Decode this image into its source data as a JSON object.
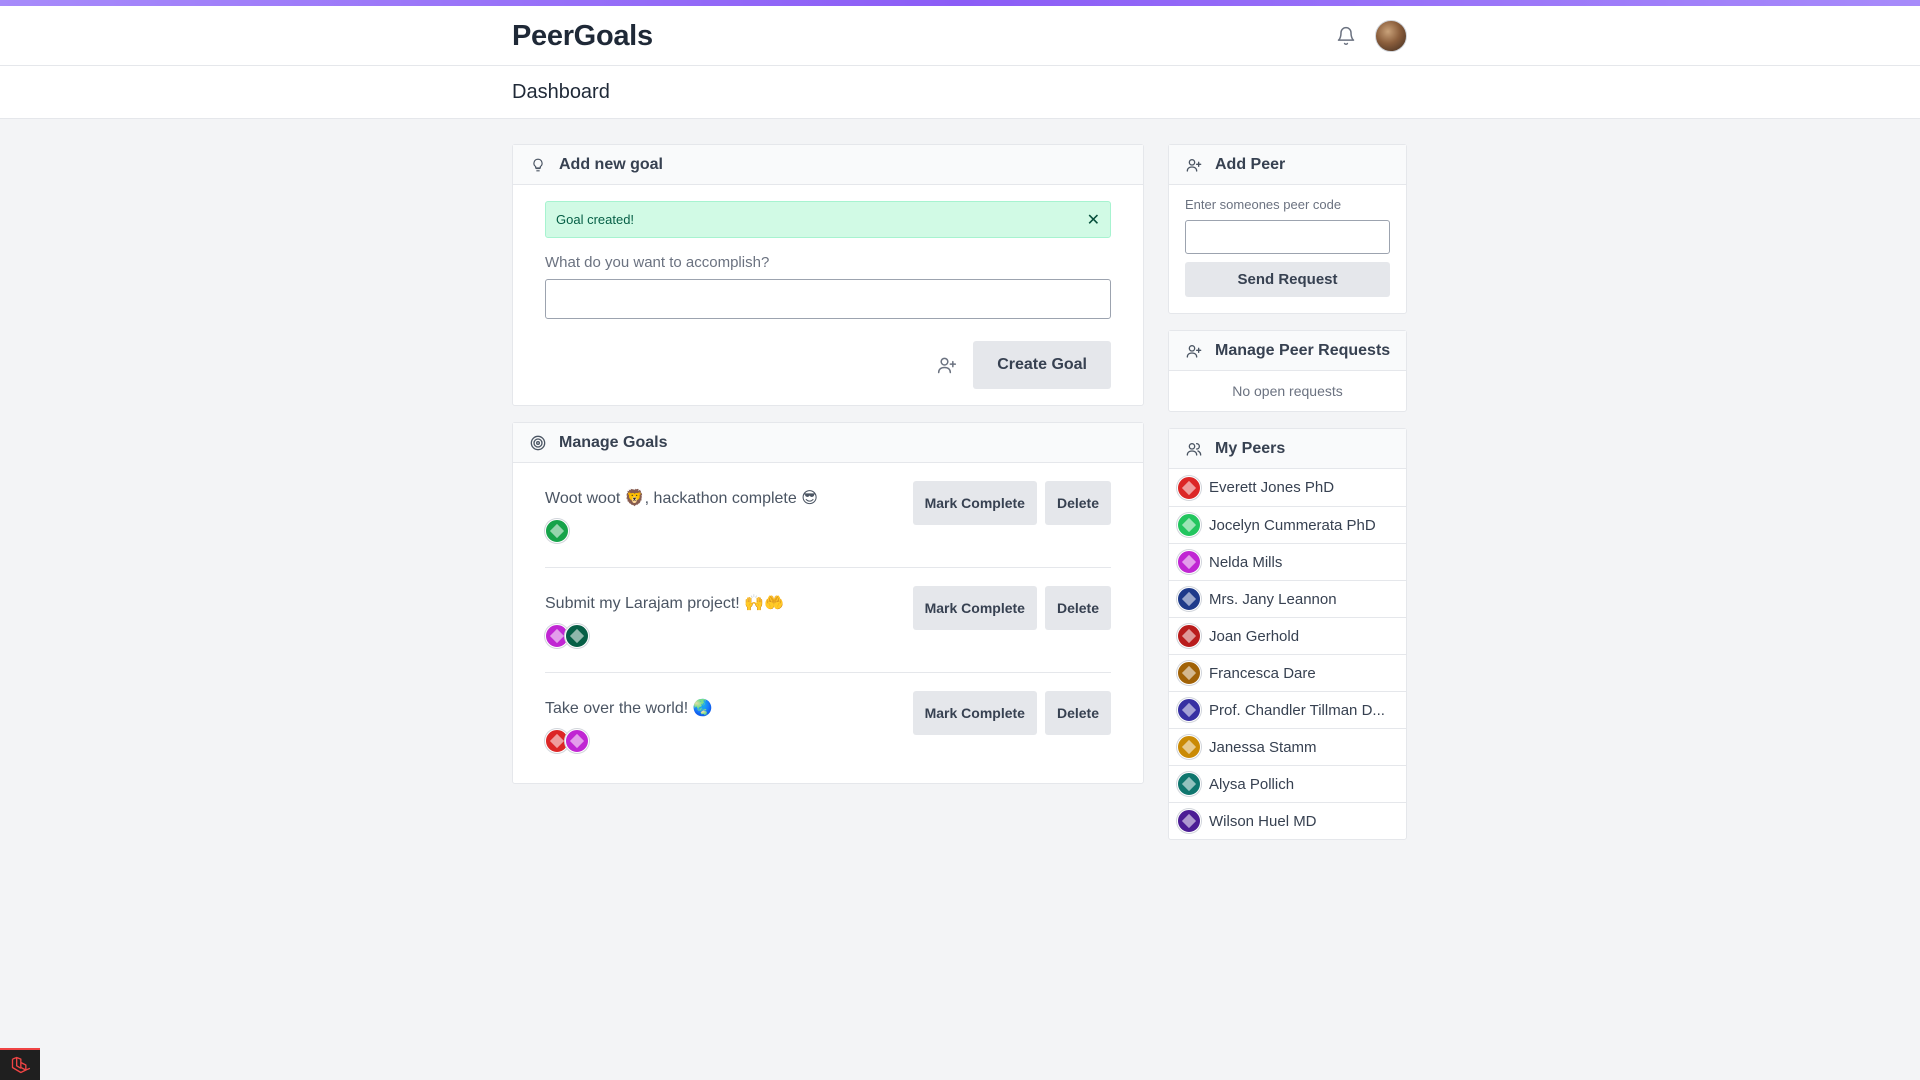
{
  "app": {
    "brand": "PeerGoals"
  },
  "header": {
    "page_title": "Dashboard"
  },
  "add_goal": {
    "title": "Add new goal",
    "alert_text": "Goal created!",
    "field_label": "What do you want to accomplish?",
    "input_value": "",
    "create_label": "Create Goal"
  },
  "manage_goals": {
    "title": "Manage Goals",
    "mark_label": "Mark Complete",
    "delete_label": "Delete",
    "goals": [
      {
        "text": "Woot woot 🦁, hackathon complete 😎",
        "avatar_colors": [
          "#16a34a"
        ]
      },
      {
        "text": "Submit my Larajam project! 🙌🤲",
        "avatar_colors": [
          "#c026d3",
          "#065f46"
        ]
      },
      {
        "text": "Take over the world! 🌏",
        "avatar_colors": [
          "#dc2626",
          "#c026d3"
        ]
      }
    ]
  },
  "add_peer": {
    "title": "Add Peer",
    "label": "Enter someones peer code",
    "input_value": "",
    "button_label": "Send Request"
  },
  "peer_requests": {
    "title": "Manage Peer Requests",
    "empty_text": "No open requests"
  },
  "my_peers": {
    "title": "My Peers",
    "peers": [
      {
        "name": "Everett Jones PhD",
        "color": "#dc2626"
      },
      {
        "name": "Jocelyn Cummerata PhD",
        "color": "#22c55e"
      },
      {
        "name": "Nelda Mills",
        "color": "#c026d3"
      },
      {
        "name": "Mrs. Jany Leannon",
        "color": "#1e3a8a"
      },
      {
        "name": "Joan Gerhold",
        "color": "#b91c1c"
      },
      {
        "name": "Francesca Dare",
        "color": "#a16207"
      },
      {
        "name": "Prof. Chandler Tillman D...",
        "color": "#3730a3"
      },
      {
        "name": "Janessa Stamm",
        "color": "#ca8a04"
      },
      {
        "name": "Alysa Pollich",
        "color": "#0f766e"
      },
      {
        "name": "Wilson Huel MD",
        "color": "#4c1d95"
      }
    ]
  }
}
